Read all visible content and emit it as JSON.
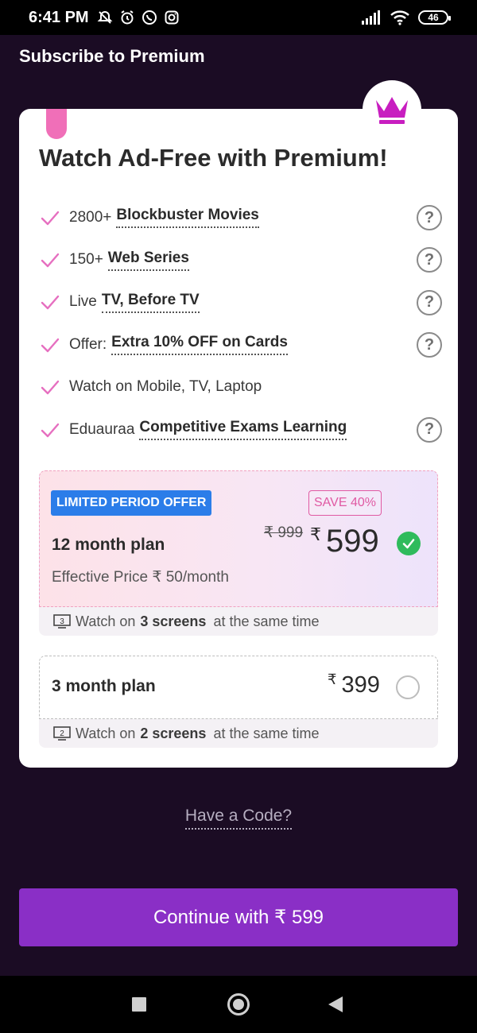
{
  "status_bar": {
    "time": "6:41 PM",
    "battery": "46"
  },
  "header": {
    "title": "Subscribe to Premium"
  },
  "card": {
    "title": "Watch Ad-Free with Premium!",
    "features": [
      {
        "prefix": "2800+",
        "highlight": "Blockbuster Movies",
        "has_help": true
      },
      {
        "prefix": "150+",
        "highlight": "Web Series",
        "has_help": true
      },
      {
        "prefix": "Live",
        "highlight": "TV, Before TV",
        "has_help": true
      },
      {
        "prefix": "Offer:",
        "highlight": "Extra 10% OFF on Cards",
        "has_help": true
      },
      {
        "prefix": "Watch on Mobile, TV, Laptop",
        "highlight": "",
        "has_help": false
      },
      {
        "prefix": "Eduauraa",
        "highlight": "Competitive Exams Learning",
        "has_help": true
      }
    ],
    "help_symbol": "?"
  },
  "plans": {
    "annual": {
      "offer_badge": "LIMITED PERIOD OFFER",
      "save_badge": "SAVE 40%",
      "name": "12 month plan",
      "old_price": "₹ 999",
      "currency": "₹",
      "price": "599",
      "effective_price": "Effective Price ₹ 50/month",
      "screens_pre": "Watch on",
      "screens_count": "3 screens",
      "screens_post": "at the same time",
      "screens_icon_num": "3",
      "selected": true
    },
    "quarterly": {
      "name": "3 month plan",
      "currency": "₹",
      "price": "399",
      "screens_pre": "Watch on",
      "screens_count": "2 screens",
      "screens_post": "at the same time",
      "screens_icon_num": "2",
      "selected": false
    }
  },
  "have_code": "Have a Code?",
  "continue_button": "Continue with ₹ 599",
  "colors": {
    "background": "#1b0c24",
    "accent_purple": "#8a2fc6",
    "check_pink": "#e66fc0",
    "offer_blue": "#2b7de9",
    "selected_green": "#2fbb5c",
    "crown_magenta": "#c81ec0"
  }
}
